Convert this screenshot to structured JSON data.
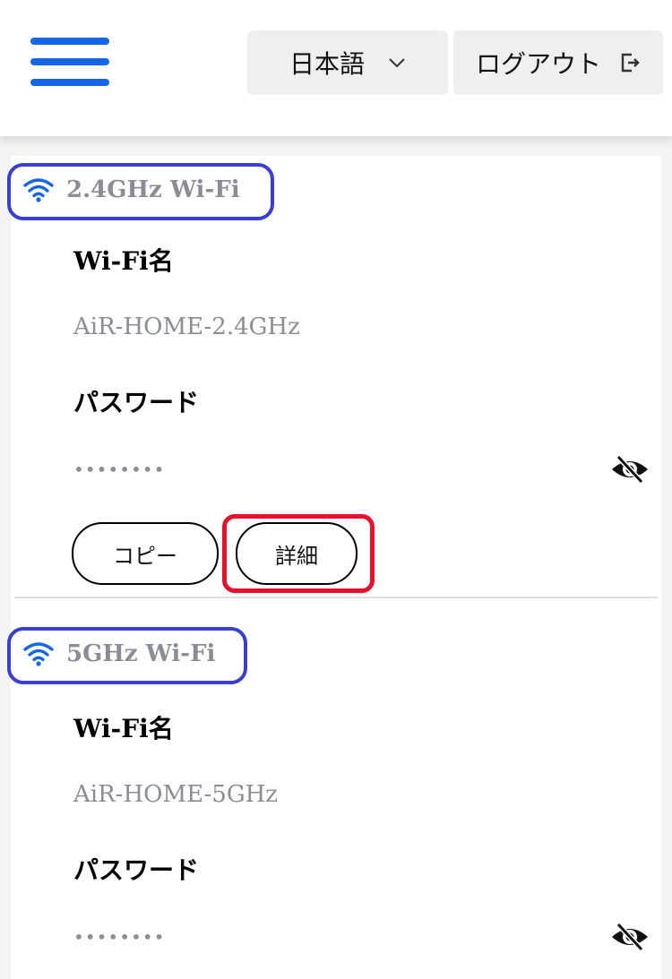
{
  "header": {
    "language_label": "日本語",
    "logout_label": "ログアウト"
  },
  "networks": [
    {
      "title": "2.4GHz Wi-Fi",
      "name_label": "Wi-Fi名",
      "ssid": "AiR-HOME-2.4GHz",
      "password_label": "パスワード",
      "password_masked": "••••••••",
      "copy_label": "コピー",
      "details_label": "詳細"
    },
    {
      "title": "5GHz Wi-Fi",
      "name_label": "Wi-Fi名",
      "ssid": "AiR-HOME-5GHz",
      "password_label": "パスワード",
      "password_masked": "••••••••"
    }
  ],
  "colors": {
    "accent": "#1565e8",
    "annotation_blue": "#3a3fd1",
    "annotation_red": "#e8102b",
    "muted_text": "#8a8d96"
  }
}
